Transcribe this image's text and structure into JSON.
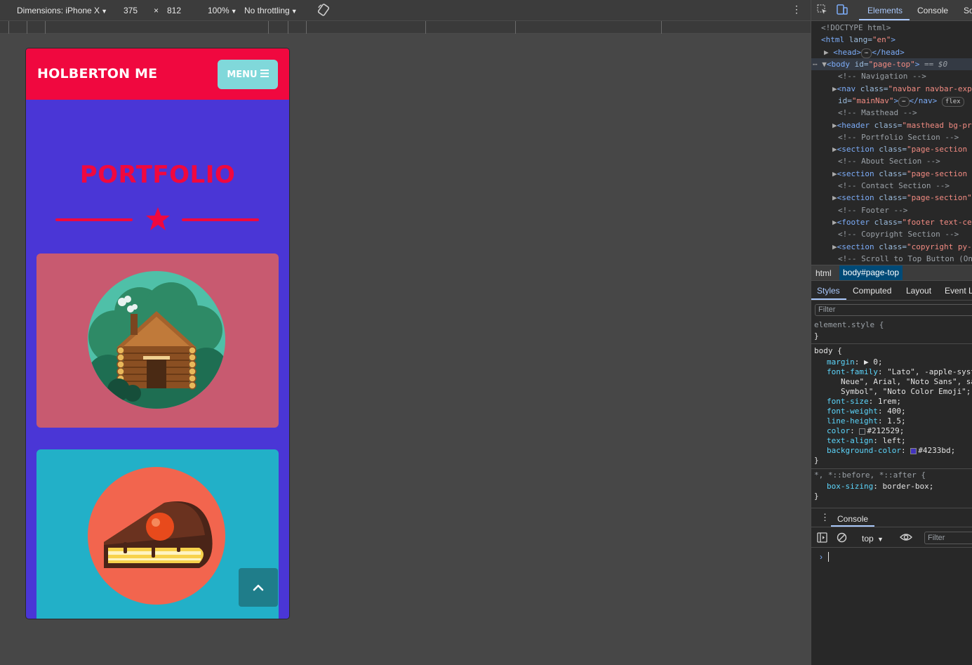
{
  "device_toolbar": {
    "dimensions_label": "Dimensions: iPhone X",
    "width": "375",
    "times": "×",
    "height": "812",
    "zoom": "100%",
    "throttling": "No throttling"
  },
  "site": {
    "brand": "HOLBERTON ME",
    "menu_label": "MENU",
    "section_title": "PORTFOLIO",
    "colors": {
      "primary": "#f0083f",
      "background": "#4a36d6",
      "menu": "#80d8da",
      "card1": "#c85a70",
      "card2": "#22b0c8"
    }
  },
  "devtools": {
    "tabs": [
      "Elements",
      "Console",
      "So"
    ],
    "dom_lines": {
      "doctype": "<!DOCTYPE html>",
      "html_open_tag": "<html",
      "html_attr": " lang=",
      "html_val": "\"en\"",
      "html_close": ">",
      "head": "<head>",
      "head_close": "</head>",
      "body_tag": "<body",
      "body_attr": " id=",
      "body_val": "\"page-top\"",
      "body_close": ">",
      "body_suffix": " == $0",
      "c_nav": "<!-- Navigation -->",
      "nav_tag": "<nav",
      "nav_attr": " class=",
      "nav_val": "\"navbar navbar-exp",
      "nav_id_attr": "id=",
      "nav_id_val": "\"mainNav\"",
      "nav_close": ">",
      "nav_end": "</nav>",
      "flex_badge": "flex",
      "c_masthead": "<!-- Masthead -->",
      "header_tag": "<header",
      "header_attr": " class=",
      "header_val": "\"masthead bg-pr",
      "c_portfolio": "<!-- Portfolio Section -->",
      "section_tag": "<section",
      "section_attr": " class=",
      "section_val": "\"page-section",
      "c_about": "<!-- About Section -->",
      "section2_val": "\"page-section",
      "c_contact": "<!-- Contact Section -->",
      "section3_val": "\"page-section\"",
      "c_footer": "<!-- Footer -->",
      "footer_tag": "<footer",
      "footer_attr": " class=",
      "footer_val": "\"footer text-ce",
      "c_copyright": "<!-- Copyright Section -->",
      "copy_tag": "<section",
      "copy_attr": " class=",
      "copy_val": "\"copyright py-",
      "c_scroll": "<!-- Scroll to Top Button (On"
    },
    "breadcrumbs": [
      "html",
      "body#page-top"
    ],
    "sub_tabs": [
      "Styles",
      "Computed",
      "Layout",
      "Event Li"
    ],
    "filter_placeholder": "Filter",
    "styles": {
      "element_style": "element.style {",
      "close": "}",
      "body_selector": "body {",
      "margin_prop": "margin",
      "margin_val": "▶ 0;",
      "font_family_prop": "font-family",
      "font_family_val1": "\"Lato\", -apple-syst",
      "font_family_val2": "Neue\", Arial, \"Noto Sans\", sa",
      "font_family_val3": "Symbol\", \"Noto Color Emoji\";",
      "font_size_prop": "font-size",
      "font_size_val": "1rem;",
      "font_weight_prop": "font-weight",
      "font_weight_val": "400;",
      "line_height_prop": "line-height",
      "line_height_val": "1.5;",
      "color_prop": "color",
      "color_val": "#212529;",
      "text_align_prop": "text-align",
      "text_align_val": "left;",
      "bg_prop": "background-color",
      "bg_val": "#4233bd;",
      "universal_selector": "*, *::before, *::after {",
      "box_sizing_prop": "box-sizing",
      "box_sizing_val": "border-box;",
      "swatch_color1": "#212529",
      "swatch_color2": "#4233bd"
    },
    "console": {
      "tab": "Console",
      "context": "top",
      "filter_placeholder": "Filter",
      "prompt": "›"
    }
  }
}
